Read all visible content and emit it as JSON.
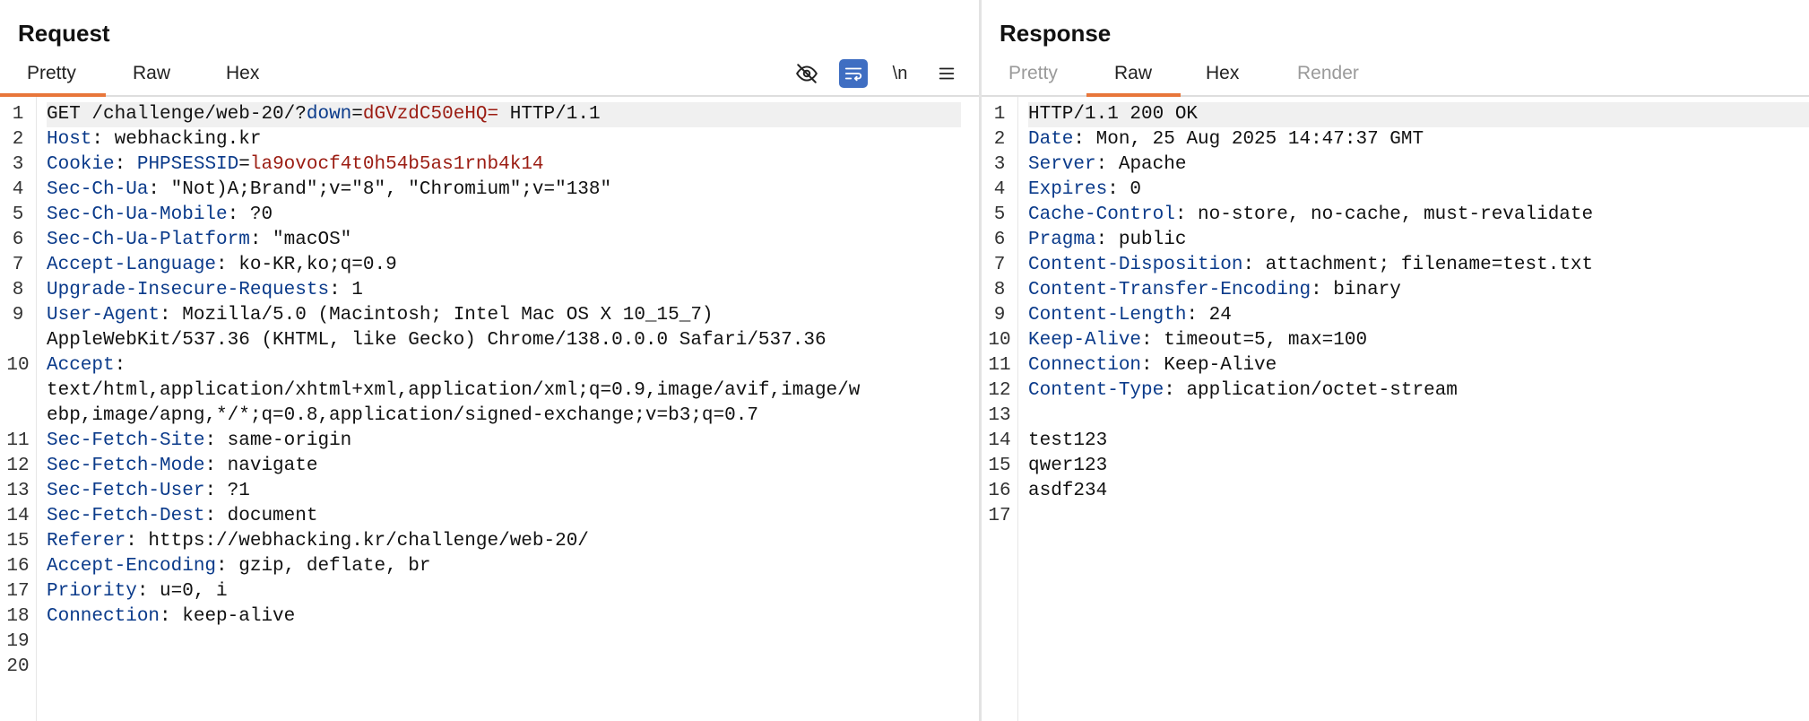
{
  "request": {
    "title": "Request",
    "tabs": [
      "Pretty",
      "Raw",
      "Hex"
    ],
    "active_tab": "Pretty",
    "icons": [
      "eye-off-icon",
      "wrap-icon",
      "newline-icon",
      "menu-icon"
    ],
    "newline_label": "\\n",
    "lines": [
      {
        "n": "1",
        "first": "GET /challenge/web-20/?",
        "param": "down",
        "eq": "=",
        "val": "dGVzdC50eHQ=",
        "rest": " HTTP/1.1"
      },
      {
        "n": "2",
        "k": "Host",
        "v": " webhacking.kr"
      },
      {
        "n": "3",
        "k": "Cookie",
        "c_name": "PHPSESSID",
        "c_eq": "=",
        "c_val": "la9ovocf4t0h54b5as1rnb4k14"
      },
      {
        "n": "4",
        "k": "Sec-Ch-Ua",
        "v": " \"Not)A;Brand\";v=\"8\", \"Chromium\";v=\"138\""
      },
      {
        "n": "5",
        "k": "Sec-Ch-Ua-Mobile",
        "v": " ?0"
      },
      {
        "n": "6",
        "k": "Sec-Ch-Ua-Platform",
        "v": " \"macOS\""
      },
      {
        "n": "7",
        "k": "Accept-Language",
        "v": " ko-KR,ko;q=0.9"
      },
      {
        "n": "8",
        "k": "Upgrade-Insecure-Requests",
        "v": " 1"
      },
      {
        "n": "9",
        "k": "User-Agent",
        "v": " Mozilla/5.0 (Macintosh; Intel Mac OS X 10_15_7)"
      },
      {
        "n": "",
        "cont": "AppleWebKit/537.36 (KHTML, like Gecko) Chrome/138.0.0.0 Safari/537.36"
      },
      {
        "n": "10",
        "k": "Accept",
        "v": ""
      },
      {
        "n": "",
        "cont": "text/html,application/xhtml+xml,application/xml;q=0.9,image/avif,image/w"
      },
      {
        "n": "",
        "cont": "ebp,image/apng,*/*;q=0.8,application/signed-exchange;v=b3;q=0.7"
      },
      {
        "n": "11",
        "k": "Sec-Fetch-Site",
        "v": " same-origin"
      },
      {
        "n": "12",
        "k": "Sec-Fetch-Mode",
        "v": " navigate"
      },
      {
        "n": "13",
        "k": "Sec-Fetch-User",
        "v": " ?1"
      },
      {
        "n": "14",
        "k": "Sec-Fetch-Dest",
        "v": " document"
      },
      {
        "n": "15",
        "k": "Referer",
        "v": " https://webhacking.kr/challenge/web-20/"
      },
      {
        "n": "16",
        "k": "Accept-Encoding",
        "v": " gzip, deflate, br"
      },
      {
        "n": "17",
        "k": "Priority",
        "v": " u=0, i"
      },
      {
        "n": "18",
        "k": "Connection",
        "v": " keep-alive"
      },
      {
        "n": "19",
        "cont": ""
      },
      {
        "n": "20",
        "cont": ""
      }
    ]
  },
  "response": {
    "title": "Response",
    "tabs": [
      "Pretty",
      "Raw",
      "Hex",
      "Render"
    ],
    "active_tab": "Raw",
    "lines": [
      {
        "n": "1",
        "cont": "HTTP/1.1 200 OK"
      },
      {
        "n": "2",
        "k": "Date",
        "v": " Mon, 25 Aug 2025 14:47:37 GMT"
      },
      {
        "n": "3",
        "k": "Server",
        "v": " Apache"
      },
      {
        "n": "4",
        "k": "Expires",
        "v": " 0"
      },
      {
        "n": "5",
        "k": "Cache-Control",
        "v": " no-store, no-cache, must-revalidate"
      },
      {
        "n": "6",
        "k": "Pragma",
        "v": " public"
      },
      {
        "n": "7",
        "k": "Content-Disposition",
        "v": " attachment; filename=test.txt"
      },
      {
        "n": "8",
        "k": "Content-Transfer-Encoding",
        "v": " binary"
      },
      {
        "n": "9",
        "k": "Content-Length",
        "v": " 24"
      },
      {
        "n": "10",
        "k": "Keep-Alive",
        "v": " timeout=5, max=100"
      },
      {
        "n": "11",
        "k": "Connection",
        "v": " Keep-Alive"
      },
      {
        "n": "12",
        "k": "Content-Type",
        "v": " application/octet-stream"
      },
      {
        "n": "13",
        "cont": ""
      },
      {
        "n": "14",
        "cont": "test123"
      },
      {
        "n": "15",
        "cont": "qwer123"
      },
      {
        "n": "16",
        "cont": "asdf234"
      },
      {
        "n": "17",
        "cont": ""
      }
    ]
  },
  "colors": {
    "accent_underline": "#e8763a",
    "active_icon_bg": "#3f6ec2",
    "header_key": "#0a3a8a",
    "param_value": "#9b1c12"
  }
}
